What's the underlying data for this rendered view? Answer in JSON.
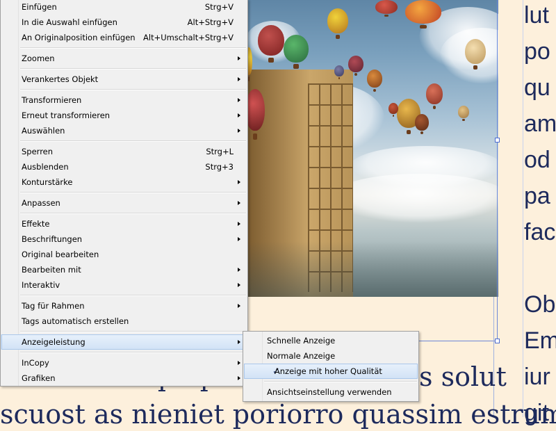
{
  "context_menu": {
    "items": [
      {
        "label": "Einfügen",
        "shortcut": "Strg+V"
      },
      {
        "label": "In die Auswahl einfügen",
        "shortcut": "Alt+Strg+V"
      },
      {
        "label": "An Originalposition einfügen",
        "shortcut": "Alt+Umschalt+Strg+V"
      },
      {
        "label": "Zoomen"
      },
      {
        "label": "Verankertes Objekt"
      },
      {
        "label": "Transformieren"
      },
      {
        "label": "Erneut transformieren"
      },
      {
        "label": "Auswählen"
      },
      {
        "label": "Sperren",
        "shortcut": "Strg+L"
      },
      {
        "label": "Ausblenden",
        "shortcut": "Strg+3"
      },
      {
        "label": "Konturstärke"
      },
      {
        "label": "Anpassen"
      },
      {
        "label": "Effekte"
      },
      {
        "label": "Beschriftungen"
      },
      {
        "label": "Original bearbeiten"
      },
      {
        "label": "Bearbeiten mit"
      },
      {
        "label": "Interaktiv"
      },
      {
        "label": "Tag für Rahmen"
      },
      {
        "label": "Tags automatisch erstellen"
      },
      {
        "label": "Anzeigeleistung"
      },
      {
        "label": "InCopy"
      },
      {
        "label": "Grafiken"
      }
    ]
  },
  "submenu": {
    "items": [
      {
        "label": "Schnelle Anzeige"
      },
      {
        "label": "Normale Anzeige"
      },
      {
        "label": "Anzeige mit hoher Qualität",
        "check": "✓"
      },
      {
        "label": "Ansichtseinstellung verwenden"
      }
    ]
  },
  "document": {
    "side_lines": [
      "lut",
      "po",
      "qu",
      "am",
      "od",
      "pa",
      "fac",
      "",
      "Ob",
      "Em",
      "iur",
      "git"
    ],
    "bottom_line_1": "atecusae explique volupta",
    "bottom_line_1_right": "s solut",
    "bottom_line_2": "scuost as nieniet poriorro quassim estrum"
  },
  "colors": {
    "page_bg": "#fdf0dc",
    "text_blue": "#1d2a5c",
    "menu_bg": "#f0f0f0",
    "highlight": "#d8e6f7",
    "frame": "#6b87d6"
  }
}
